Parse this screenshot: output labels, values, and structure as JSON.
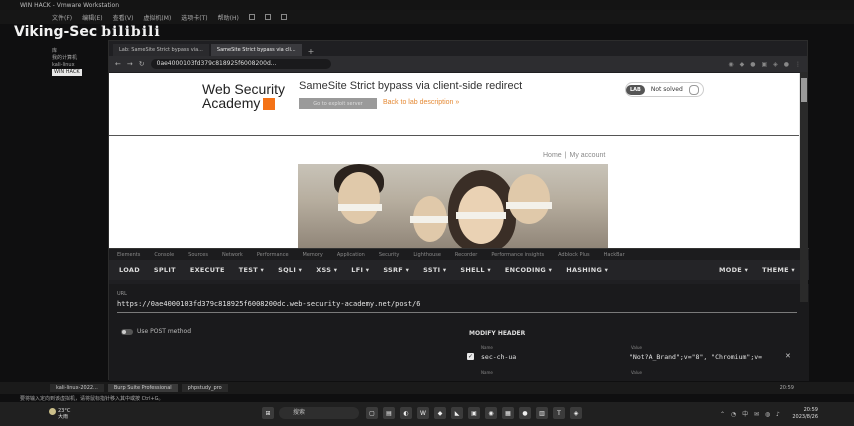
{
  "vm": {
    "title": "WIN HACK - Vmware Workstation",
    "menu": [
      "文件(F)",
      "编辑(E)",
      "查看(V)",
      "虚拟机(M)",
      "选项卡(T)",
      "帮助(H)"
    ],
    "library_title": "库",
    "library_items": [
      "我的计算机",
      "kali-linux",
      "WIN HACK"
    ],
    "tabs": [
      "kali-linux-2022...",
      "Burp Suite Professional",
      "phpstudy_pro"
    ],
    "clock": "20:59",
    "hint": "要将输入定向到该虚拟机，请将鼠标指针移入其中或按 Ctrl+G。"
  },
  "watermark": {
    "name": "Viking-Sec",
    "site": "bilibili"
  },
  "browser": {
    "tabs": [
      "Lab: SameSite Strict bypass via...",
      "SameSite Strict bypass via cli..."
    ],
    "url": "0ae4000103fd379c818925f6008200d..."
  },
  "page": {
    "logo_line1": "Web Security",
    "logo_line2": "Academy",
    "lab_title": "SameSite Strict bypass via client-side redirect",
    "access_button": "Go to exploit server",
    "back_link": "Back to lab description",
    "back_arrow": "»",
    "status_badge": "LAB",
    "status_text": "Not solved",
    "nav_home": "Home",
    "nav_sep": "|",
    "nav_account": "My account"
  },
  "devtools": {
    "tabs": [
      "Elements",
      "Console",
      "Sources",
      "Network",
      "Performance",
      "Memory",
      "Application",
      "Security",
      "Lighthouse",
      "Recorder",
      "Performance insights",
      "Adblock Plus",
      "HackBar"
    ]
  },
  "hackbar": {
    "left": [
      "LOAD",
      "SPLIT",
      "EXECUTE",
      "TEST ▾",
      "SQLI ▾",
      "XSS ▾",
      "LFI ▾",
      "SSRF ▾",
      "SSTI ▾",
      "SHELL ▾",
      "ENCODING ▾",
      "HASHING ▾"
    ],
    "right": [
      "MODE ▾",
      "THEME ▾"
    ],
    "url_label": "URL",
    "url_value": "https://0ae4000103fd379c818925f6008200dc.web-security-academy.net/post/6",
    "post_label": "Use POST method",
    "modify_header": "MODIFY HEADER",
    "field_name_label": "Name",
    "field_value_label": "Value",
    "header_name": "sec-ch-ua",
    "header_value": "\"Not?A_Brand\";v=\"8\", \"Chromium\";v=",
    "close": "✕"
  },
  "taskbar": {
    "weather_temp": "23°C",
    "weather_desc": "大雨",
    "search": "搜索",
    "time": "20:59",
    "date": "2023/8/26"
  }
}
